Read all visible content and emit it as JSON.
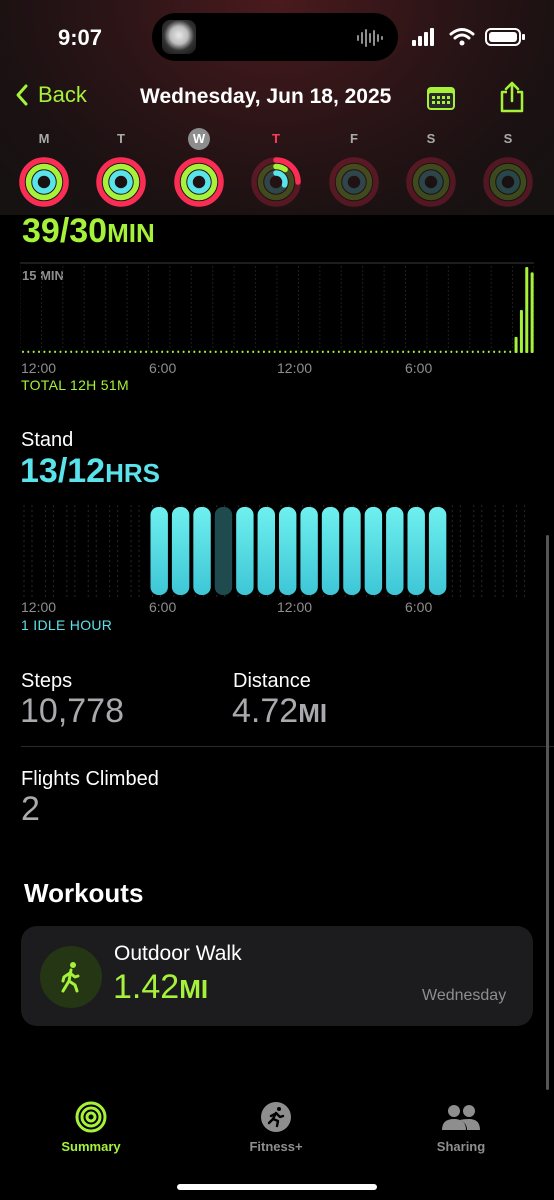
{
  "status_bar": {
    "time": "9:07"
  },
  "nav": {
    "back_label": "Back",
    "title": "Wednesday, Jun 18, 2025"
  },
  "week": {
    "days": [
      {
        "label": "M",
        "move": 1.0,
        "exercise": 1.0,
        "stand": 1.0
      },
      {
        "label": "T",
        "move": 1.0,
        "exercise": 1.0,
        "stand": 1.0
      },
      {
        "label": "W",
        "move": 1.0,
        "exercise": 1.0,
        "stand": 1.0,
        "selected": true
      },
      {
        "label": "T",
        "move": 0.25,
        "exercise": 0.1,
        "stand": 0.3,
        "today": true
      },
      {
        "label": "F",
        "move": 0,
        "exercise": 0,
        "stand": 0
      },
      {
        "label": "S",
        "move": 0,
        "exercise": 0,
        "stand": 0
      },
      {
        "label": "S",
        "move": 0,
        "exercise": 0,
        "stand": 0
      }
    ],
    "colors": {
      "move": "#fa2d55",
      "exercise": "#a6f23a",
      "stand": "#5be3ec"
    }
  },
  "exercise": {
    "value": "39/30",
    "unit": "MIN",
    "scale_label": "15 MIN",
    "axis_labels": [
      "12:00",
      "6:00",
      "12:00",
      "6:00"
    ],
    "total_label": "TOTAL 12H 51M",
    "spikes": [
      {
        "slot": 92,
        "minutes": 3
      },
      {
        "slot": 93,
        "minutes": 8
      },
      {
        "slot": 94,
        "minutes": 16
      },
      {
        "slot": 95,
        "minutes": 15
      }
    ]
  },
  "stand": {
    "title": "Stand",
    "value": "13/12",
    "unit": "HRS",
    "axis_labels": [
      "12:00",
      "6:00",
      "12:00",
      "6:00"
    ],
    "idle_label": "1 IDLE HOUR",
    "hours": [
      0,
      0,
      0,
      0,
      0,
      0,
      1,
      1,
      1,
      0,
      1,
      1,
      1,
      1,
      1,
      1,
      1,
      1,
      1,
      1,
      0,
      0,
      0,
      0
    ]
  },
  "stats": {
    "steps": {
      "label": "Steps",
      "value": "10,778"
    },
    "distance": {
      "label": "Distance",
      "value": "4.72",
      "unit": "MI"
    },
    "flights": {
      "label": "Flights Climbed",
      "value": "2"
    }
  },
  "workouts": {
    "heading": "Workouts",
    "items": [
      {
        "name": "Outdoor Walk",
        "value": "1.42",
        "unit": "MI",
        "day": "Wednesday",
        "icon": "walking-figure-icon"
      }
    ]
  },
  "tabbar": {
    "items": [
      {
        "label": "Summary",
        "icon": "activity-rings-icon",
        "active": true
      },
      {
        "label": "Fitness+",
        "icon": "running-figure-icon"
      },
      {
        "label": "Sharing",
        "icon": "people-icon"
      }
    ]
  }
}
